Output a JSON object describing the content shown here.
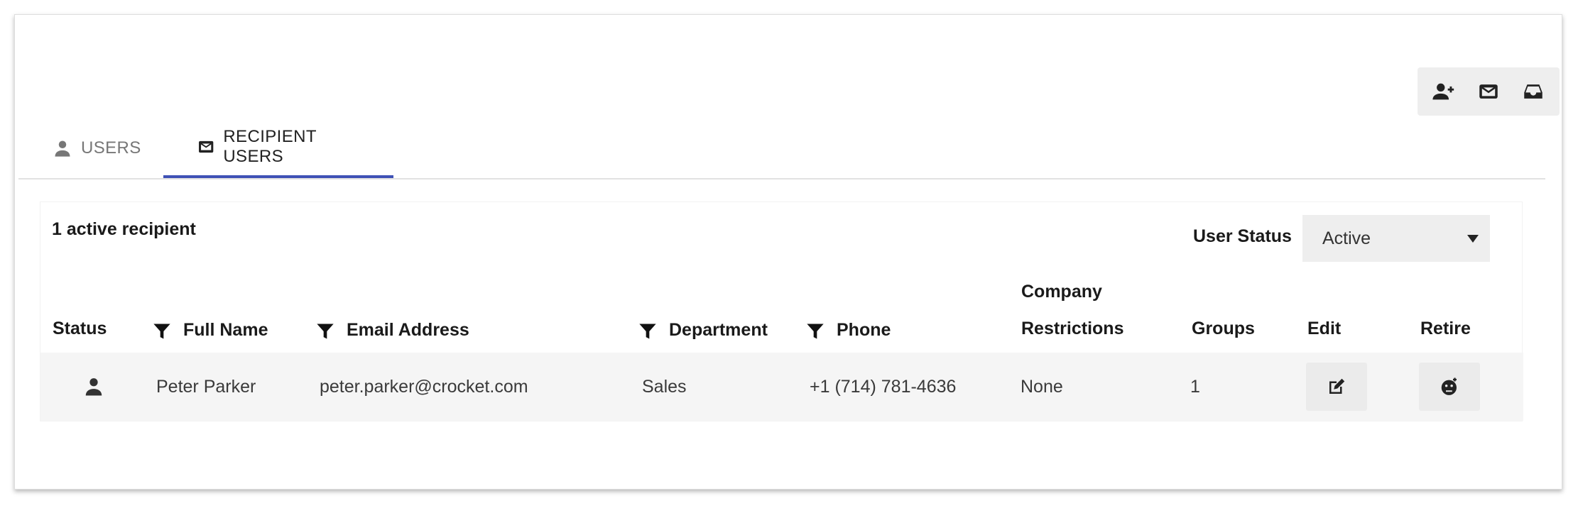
{
  "toolbar": {
    "icons": [
      "add-user-icon",
      "mail-icon",
      "inbox-icon"
    ]
  },
  "tabs": [
    {
      "label": "USERS",
      "icon": "person-icon",
      "active": false
    },
    {
      "label": "RECIPIENT USERS",
      "icon": "mail-icon",
      "active": true
    }
  ],
  "summary": {
    "count_label": "1 active recipient"
  },
  "status_filter": {
    "label": "User Status",
    "value": "Active"
  },
  "table": {
    "headers": {
      "status": "Status",
      "full_name": "Full Name",
      "email": "Email Address",
      "department": "Department",
      "phone": "Phone",
      "company_line1": "Company",
      "company_line2": "Restrictions",
      "groups": "Groups",
      "edit": "Edit",
      "retire": "Retire"
    },
    "rows": [
      {
        "status_icon": "person-icon",
        "full_name": "Peter Parker",
        "email": "peter.parker@crocket.com",
        "department": "Sales",
        "phone": "+1 (714) 781-4636",
        "company_restrictions": "None",
        "groups": "1"
      }
    ]
  },
  "colors": {
    "accent": "#3f51b5",
    "toolbar_bg": "#eeeeee",
    "row_bg": "#f5f5f5"
  }
}
